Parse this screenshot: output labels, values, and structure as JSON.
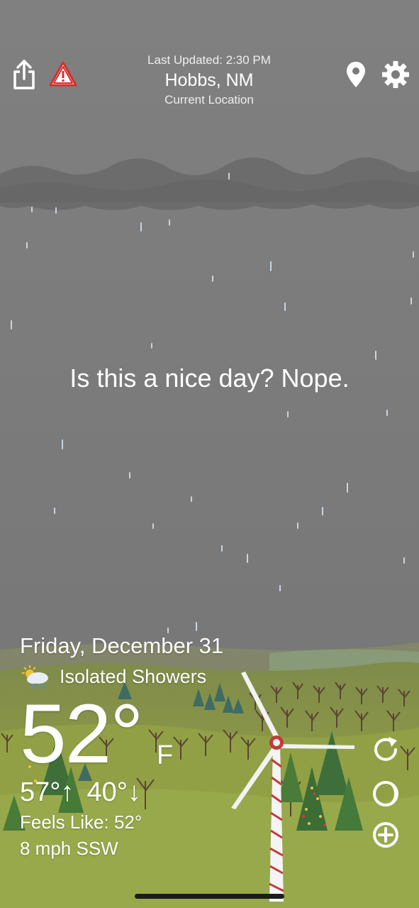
{
  "header": {
    "last_updated": "Last Updated: 2:30 PM",
    "city": "Hobbs, NM",
    "location_label": "Current Location"
  },
  "headline": "Is this a nice day? Nope.",
  "weather": {
    "date": "Friday, December 31",
    "condition": "Isolated Showers",
    "temperature": "52°",
    "unit": "F",
    "high": "57°↑",
    "low": "40°↓",
    "feels_like": "Feels Like: 52°",
    "wind": "8 mph SSW"
  },
  "icons": {
    "share": "share-icon",
    "alert": "warning-triangle-icon",
    "location": "map-pin-icon",
    "settings": "gear-icon",
    "condition": "partly-cloudy-rain-icon",
    "refresh": "refresh-icon",
    "moon": "moon-phase-icon",
    "add": "plus-circle-icon"
  },
  "colors": {
    "sky": "#7b7b7b",
    "cloud_band": "#6c6c6c",
    "hills": "#8b9a45",
    "alert_red": "#d32f2f",
    "text": "#ffffff"
  }
}
